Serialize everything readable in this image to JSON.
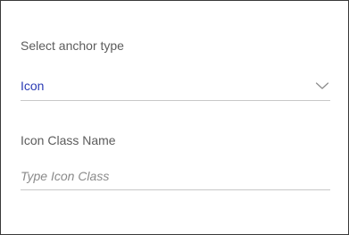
{
  "anchor_type": {
    "label": "Select anchor type",
    "selected_value": "Icon",
    "value_color": "#2b3bb4",
    "chevron_icon": "chevron-down-icon"
  },
  "icon_class": {
    "label": "Icon Class Name",
    "value": "",
    "placeholder": "Type Icon Class"
  }
}
